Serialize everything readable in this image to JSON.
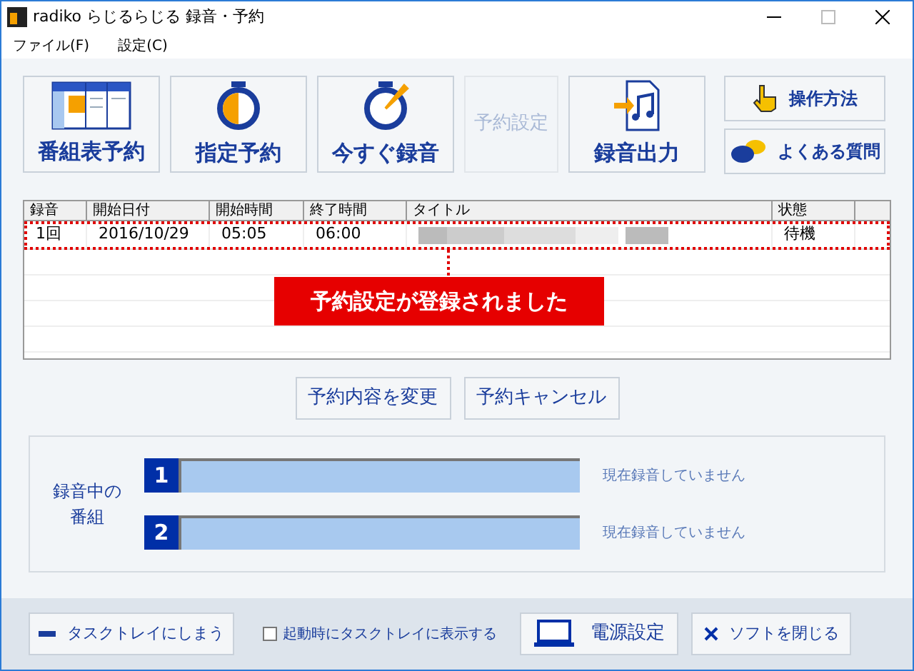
{
  "window": {
    "title": "radiko らじるらじる 録音・予約"
  },
  "menu": [
    "ファイル(F)",
    "設定(C)"
  ],
  "toolbar": [
    {
      "kind": "schedule",
      "label": "番組表予約",
      "disabled": false
    },
    {
      "kind": "timer",
      "label": "指定予約",
      "disabled": false
    },
    {
      "kind": "now",
      "label": "今すぐ録音",
      "disabled": false
    },
    {
      "kind": "plain",
      "label": "予約設定",
      "disabled": true
    },
    {
      "kind": "export",
      "label": "録音出力",
      "disabled": false
    }
  ],
  "help_buttons": [
    {
      "kind": "hand",
      "label": "操作方法"
    },
    {
      "kind": "qa",
      "label": "よくある質問"
    }
  ],
  "table": {
    "columns": [
      "録音",
      "開始日付",
      "開始時間",
      "終了時間",
      "タイトル",
      "状態"
    ],
    "rows": [
      {
        "cells": [
          "1回",
          "2016/10/29",
          "05:05",
          "06:00",
          "",
          "待機"
        ],
        "highlighted": true
      }
    ]
  },
  "callout": "予約設定が登録されました",
  "row_buttons": [
    "予約内容を変更",
    "予約キャンセル"
  ],
  "recording": {
    "label": "録音中の番組",
    "slots": [
      {
        "number": "1",
        "status": "現在録音していません"
      },
      {
        "number": "2",
        "status": "現在録音していません"
      }
    ]
  },
  "footer": {
    "tray_button": "タスクトレイにしまう",
    "startup_checkbox": {
      "label": "起動時にタスクトレイに表示する",
      "checked": false
    },
    "power_button": "電源設定",
    "close_button": "ソフトを閉じる"
  }
}
